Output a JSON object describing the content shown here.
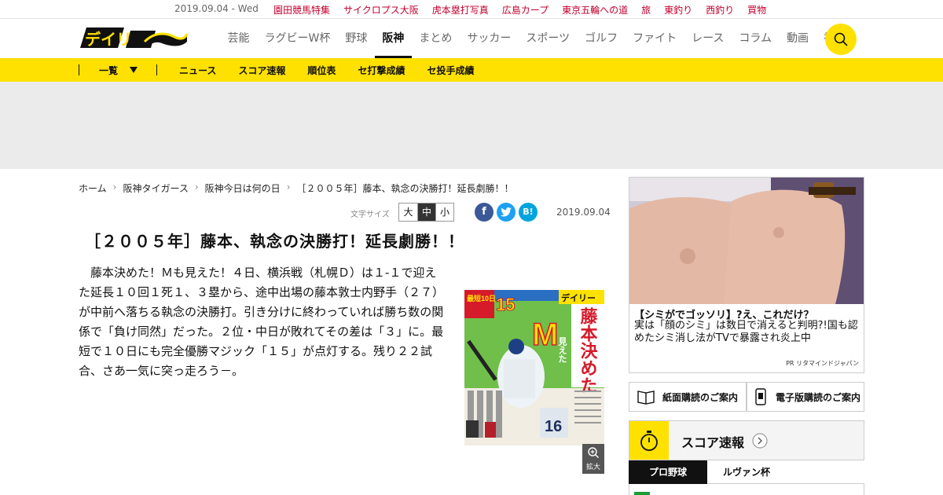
{
  "topbar": {
    "date": "2019.09.04 - Wed",
    "links": [
      "園田競馬特集",
      "サイクロプス大阪",
      "虎本塁打写真",
      "広島カープ",
      "東京五輪への道",
      "旅",
      "東釣り",
      "西釣り",
      "買物"
    ]
  },
  "header": {
    "logo_text": "デイリー",
    "nav": [
      "芸能",
      "ラグビーW杯",
      "野球",
      "阪神",
      "まとめ",
      "サッカー",
      "スポーツ",
      "ゴルフ",
      "ファイト",
      "レース",
      "コラム",
      "動画",
      "社会"
    ],
    "active_nav": "阪神"
  },
  "subnav": {
    "all_label": "一覧",
    "links": [
      "ニュース",
      "スコア速報",
      "順位表",
      "セ打撃成績",
      "セ投手成績"
    ]
  },
  "breadcrumb": [
    "ホーム",
    "阪神タイガース",
    "阪神今日は何の日",
    "［２００５年］藤本、執念の決勝打！延長劇勝！！"
  ],
  "tools": {
    "fontsize_label": "文字サイズ",
    "fontsize_options": [
      "大",
      "中",
      "小"
    ],
    "fontsize_selected": "中",
    "share": [
      "f",
      "t",
      "B!"
    ],
    "date": "2019.09.04"
  },
  "article": {
    "title": "［２００５年］藤本、執念の決勝打！延長劇勝！！",
    "body": "　藤本決めた！Ｍも見えた！４日、横浜戦（札幌Ｄ）は１-１で迎えた延長１０回１死１、３塁から、途中出場の藤本敦士内野手（２７）が中前へ落ちる執念の決勝打。引き分けに終わっていれば勝ち数の関係で「負け同然」だった。２位・中日が敗れてその差は「３」に。最短で１０日にも完全優勝マジック「１５」が点灯する。残り２２試合、さあ一気に突っ走ろう－。",
    "zoom_label": "拡大",
    "front_page": {
      "masthead": "デイリー",
      "magic_number": "15",
      "headline": "藤本決めた",
      "big_letter": "M",
      "sub_headline": "見えた",
      "uniform_number": "16",
      "date_tag": "最短10日"
    }
  },
  "sidebar": {
    "ad": {
      "headline": "【シミがでゴッソリ】?え、これだけ？",
      "text": "実は「顔のシミ」は数日で消えると判明?!国も認めたシミ消し法がTVで暴露され炎上中",
      "sponsor": "PR リタマインドジャパン"
    },
    "subscribe_paper": "紙面購読のご案内",
    "subscribe_digital": "電子版購読のご案内",
    "score": {
      "title": "スコア速報",
      "tabs": [
        "プロ野球",
        "ルヴァン杯"
      ],
      "active_tab": "プロ野球"
    }
  },
  "colors": {
    "accent": "#ffe100",
    "link_red": "#c3002f",
    "facebook": "#3b5998",
    "twitter": "#1da1f2",
    "hatena": "#00a4de"
  }
}
